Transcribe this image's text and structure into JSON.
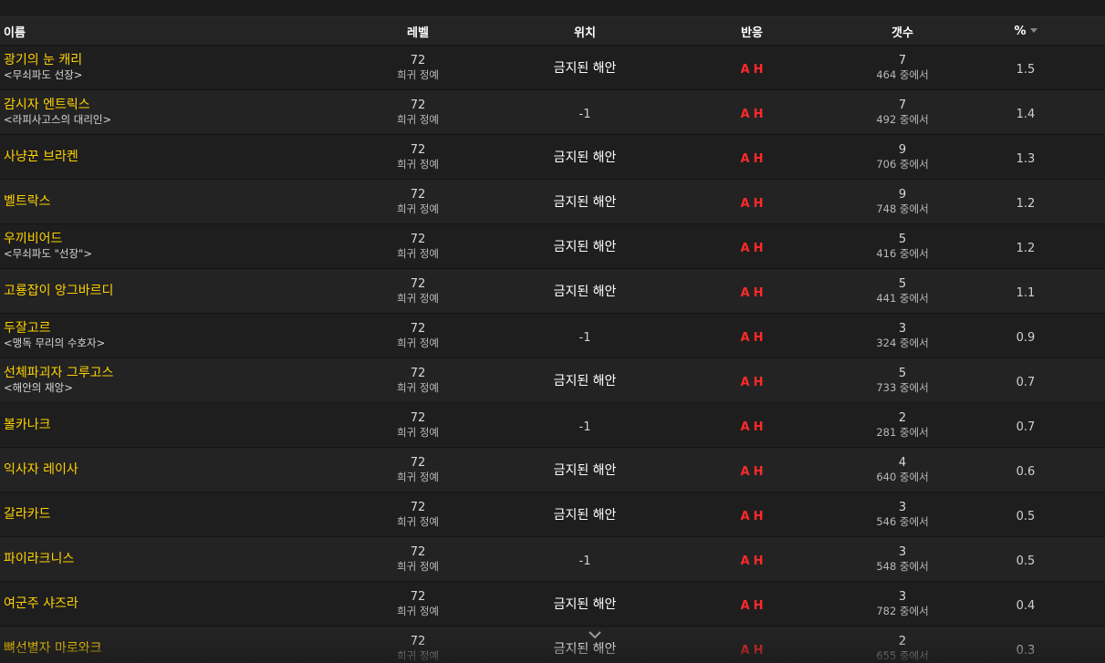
{
  "columns": {
    "name": "이름",
    "level": "레벨",
    "location": "위치",
    "react": "반응",
    "count": "갯수",
    "percent": "%"
  },
  "colors": {
    "name": "#ffd100",
    "react": "#ff2a2a"
  },
  "rows": [
    {
      "name": "광기의 눈 캐리",
      "sub": "<무쇠파도 선장>",
      "level": "72",
      "rank": "희귀 정예",
      "location": "금지된 해안",
      "react_a": "A",
      "react_h": "H",
      "count": "7",
      "count_of": "464 중에서",
      "percent": "1.5"
    },
    {
      "name": "감시자 엔트릭스",
      "sub": "<라피사고스의 대리인>",
      "level": "72",
      "rank": "희귀 정예",
      "location": "-1",
      "react_a": "A",
      "react_h": "H",
      "count": "7",
      "count_of": "492 중에서",
      "percent": "1.4"
    },
    {
      "name": "사냥꾼 브라켄",
      "sub": "",
      "level": "72",
      "rank": "희귀 정예",
      "location": "금지된 해안",
      "react_a": "A",
      "react_h": "H",
      "count": "9",
      "count_of": "706 중에서",
      "percent": "1.3"
    },
    {
      "name": "벨트락스",
      "sub": "",
      "level": "72",
      "rank": "희귀 정예",
      "location": "금지된 해안",
      "react_a": "A",
      "react_h": "H",
      "count": "9",
      "count_of": "748 중에서",
      "percent": "1.2"
    },
    {
      "name": "우끼비어드",
      "sub": "<무쇠파도 \"선장\">",
      "level": "72",
      "rank": "희귀 정예",
      "location": "금지된 해안",
      "react_a": "A",
      "react_h": "H",
      "count": "5",
      "count_of": "416 중에서",
      "percent": "1.2"
    },
    {
      "name": "고룡잡이 앙그바르디",
      "sub": "",
      "level": "72",
      "rank": "희귀 정예",
      "location": "금지된 해안",
      "react_a": "A",
      "react_h": "H",
      "count": "5",
      "count_of": "441 중에서",
      "percent": "1.1"
    },
    {
      "name": "두잘고르",
      "sub": "<맹독 무리의 수호자>",
      "level": "72",
      "rank": "희귀 정예",
      "location": "-1",
      "react_a": "A",
      "react_h": "H",
      "count": "3",
      "count_of": "324 중에서",
      "percent": "0.9"
    },
    {
      "name": "선체파괴자 그루고스",
      "sub": "<해안의 재앙>",
      "level": "72",
      "rank": "희귀 정예",
      "location": "금지된 해안",
      "react_a": "A",
      "react_h": "H",
      "count": "5",
      "count_of": "733 중에서",
      "percent": "0.7"
    },
    {
      "name": "볼카나크",
      "sub": "",
      "level": "72",
      "rank": "희귀 정예",
      "location": "-1",
      "react_a": "A",
      "react_h": "H",
      "count": "2",
      "count_of": "281 중에서",
      "percent": "0.7"
    },
    {
      "name": "익사자 레이사",
      "sub": "",
      "level": "72",
      "rank": "희귀 정예",
      "location": "금지된 해안",
      "react_a": "A",
      "react_h": "H",
      "count": "4",
      "count_of": "640 중에서",
      "percent": "0.6"
    },
    {
      "name": "갈라카드",
      "sub": "",
      "level": "72",
      "rank": "희귀 정예",
      "location": "금지된 해안",
      "react_a": "A",
      "react_h": "H",
      "count": "3",
      "count_of": "546 중에서",
      "percent": "0.5"
    },
    {
      "name": "파이라크니스",
      "sub": "",
      "level": "72",
      "rank": "희귀 정예",
      "location": "-1",
      "react_a": "A",
      "react_h": "H",
      "count": "3",
      "count_of": "548 중에서",
      "percent": "0.5"
    },
    {
      "name": "여군주 샤즈라",
      "sub": "",
      "level": "72",
      "rank": "희귀 정예",
      "location": "금지된 해안",
      "react_a": "A",
      "react_h": "H",
      "count": "3",
      "count_of": "782 중에서",
      "percent": "0.4"
    },
    {
      "name": "뼈선별자 마로와크",
      "sub": "",
      "level": "72",
      "rank": "희귀 정예",
      "location": "금지된 해안",
      "react_a": "A",
      "react_h": "H",
      "count": "2",
      "count_of": "655 중에서",
      "percent": "0.3"
    }
  ]
}
